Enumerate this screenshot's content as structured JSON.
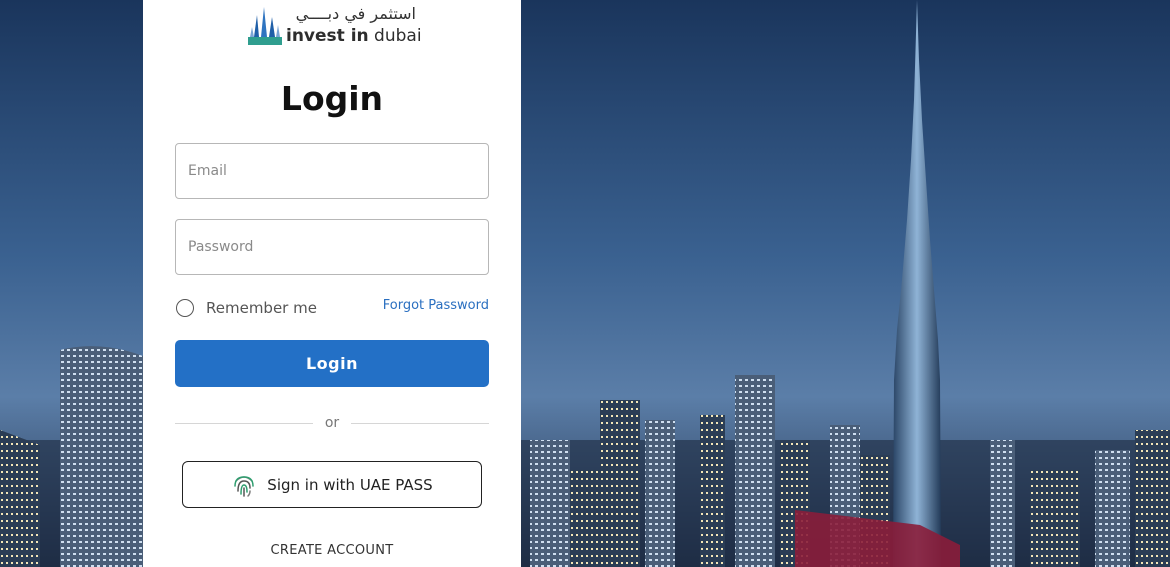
{
  "logo": {
    "arabic_text": "استثمر في دبــــي",
    "english_bold": "invest in",
    "english_regular": " dubai"
  },
  "login": {
    "title": "Login",
    "email_placeholder": "Email",
    "password_placeholder": "Password",
    "remember_label": "Remember me",
    "forgot_label": "Forgot Password",
    "login_button": "Login",
    "or_label": "or",
    "uae_pass_label": "Sign in with UAE PASS",
    "create_account": "CREATE ACCOUNT"
  },
  "colors": {
    "primary": "#2370c6",
    "link": "#2a6fc0",
    "background_sky": "#2f5483"
  }
}
